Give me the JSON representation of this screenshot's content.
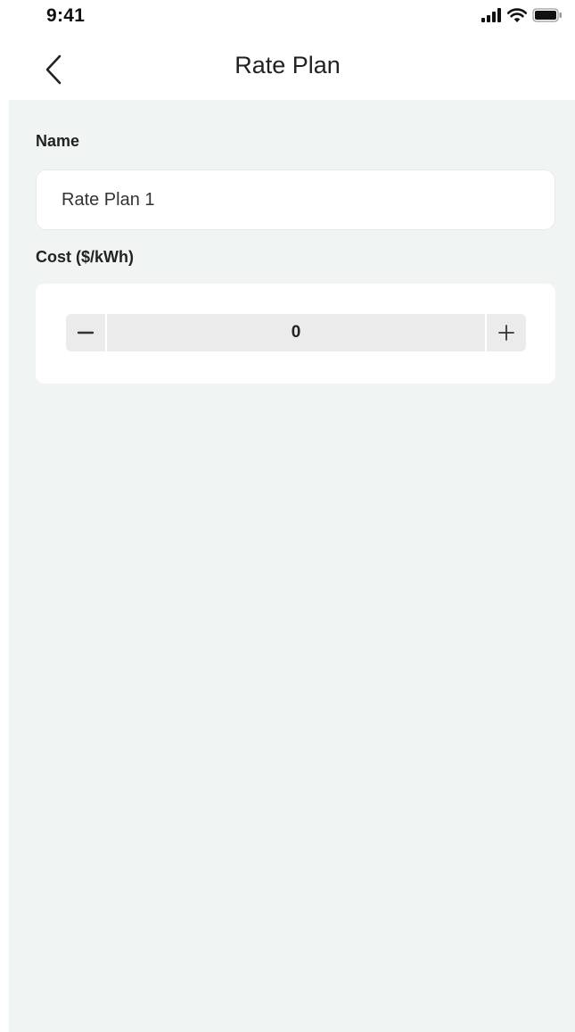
{
  "status_bar": {
    "time": "9:41",
    "icons": [
      "signal-icon",
      "wifi-icon",
      "battery-icon"
    ]
  },
  "nav": {
    "title": "Rate Plan",
    "back_icon": "chevron-left-icon"
  },
  "form": {
    "name_label": "Name",
    "name_value": "Rate Plan 1",
    "cost_label": "Cost ($/kWh)",
    "cost_value": "0",
    "decrement_icon": "minus-icon",
    "increment_icon": "plus-icon"
  },
  "colors": {
    "page_background": "#f0f5f3",
    "card_background": "#ffffff",
    "stepper_background": "#ebebeb"
  }
}
